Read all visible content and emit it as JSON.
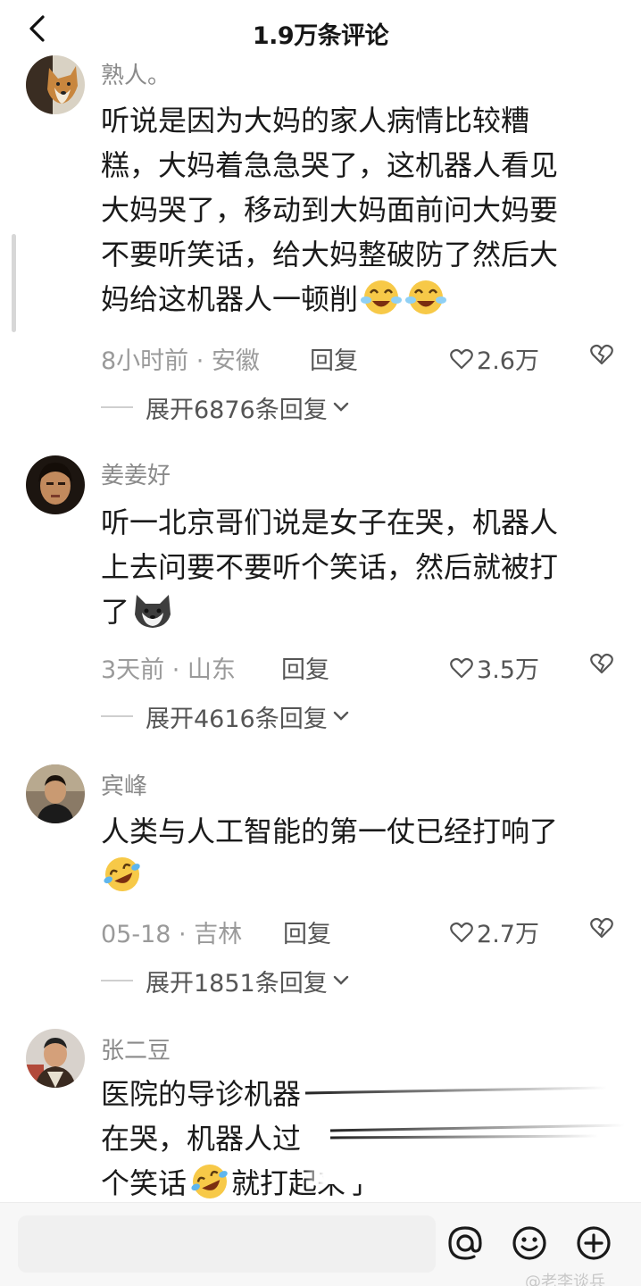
{
  "header": {
    "title": "1.9万条评论",
    "back_icon": "chevron-left-icon"
  },
  "comments": [
    {
      "author": "熟人。",
      "avatar_icon": "dog-avatar",
      "lines": [
        "听说是因为大妈的家人病情比较糟",
        "糕，大妈着急急哭了，这机器人看见",
        "大妈哭了，移动到大妈面前问大妈要",
        "不要听笑话，给大妈整破防了然后大",
        "妈给这机器人一顿削"
      ],
      "emojis": [
        "crying-laughing-emoji",
        "crying-laughing-emoji"
      ],
      "time": "8小时前 · 安徽",
      "reply": "回复",
      "likes": "2.6万",
      "expand": "展开6876条回复"
    },
    {
      "author": "姜姜好",
      "avatar_icon": "person-avatar",
      "lines": [
        "听一北京哥们说是女子在哭，机器人",
        "上去问要不要听个笑话，然后就被打",
        "了"
      ],
      "emojis": [
        "husky-emoji"
      ],
      "time": "3天前 · 山东",
      "reply": "回复",
      "likes": "3.5万",
      "expand": "展开4616条回复"
    },
    {
      "author": "宾峰",
      "avatar_icon": "person-avatar",
      "lines": [
        "人类与人工智能的第一仗已经打响了"
      ],
      "emojis": [
        "rolling-laughing-emoji"
      ],
      "time": "05-18 · 吉林",
      "reply": "回复",
      "likes": "2.7万",
      "expand": "展开1851条回复"
    },
    {
      "author": "张二豆",
      "avatar_icon": "person-avatar",
      "lines": [
        "医院的导诊机器",
        "在哭，机器人过",
        "个笑话",
        "就打起来了"
      ],
      "emojis": [
        "rolling-laughing-emoji"
      ]
    }
  ],
  "bottom_bar": {
    "icons": [
      "at-icon",
      "smile-icon",
      "plus-circle-icon"
    ],
    "watermark": "@老李谈兵"
  }
}
